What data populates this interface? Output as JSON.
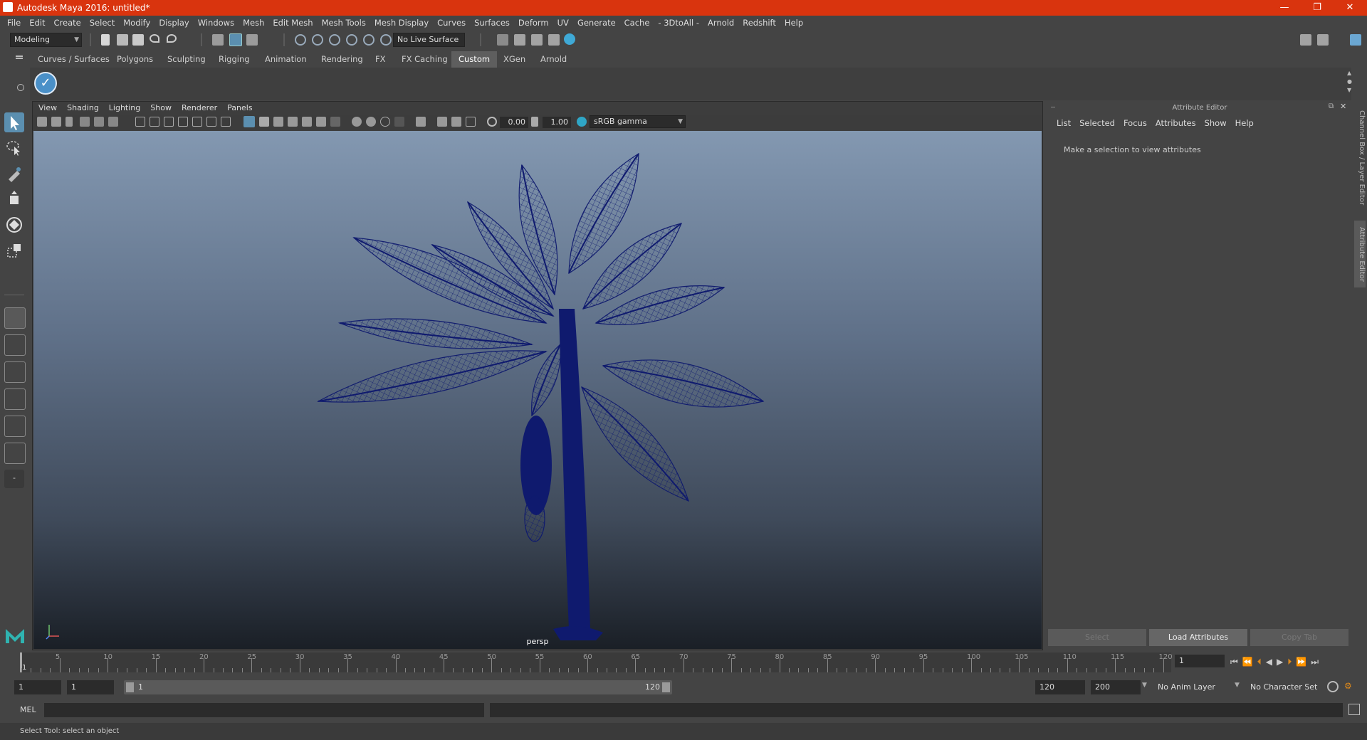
{
  "window": {
    "title": "Autodesk Maya 2016: untitled*",
    "minimize": "—",
    "restore": "❐",
    "close": "✕"
  },
  "menu": [
    "File",
    "Edit",
    "Create",
    "Select",
    "Modify",
    "Display",
    "Windows",
    "Mesh",
    "Edit Mesh",
    "Mesh Tools",
    "Mesh Display",
    "Curves",
    "Surfaces",
    "Deform",
    "UV",
    "Generate",
    "Cache",
    "- 3DtoAll -",
    "Arnold",
    "Redshift",
    "Help"
  ],
  "status": {
    "menuset": "Modeling",
    "live_surface": "No Live Surface"
  },
  "shelf_tabs": [
    "Curves / Surfaces",
    "Polygons",
    "Sculpting",
    "Rigging",
    "Animation",
    "Rendering",
    "FX",
    "FX Caching",
    "Custom",
    "XGen",
    "Arnold"
  ],
  "shelf_active": "Custom",
  "viewport": {
    "menu": [
      "View",
      "Shading",
      "Lighting",
      "Show",
      "Renderer",
      "Panels"
    ],
    "exposure": "0.00",
    "gamma": "1.00",
    "colorspace": "sRGB gamma",
    "camera": "persp"
  },
  "attribute_editor": {
    "title": "Attribute Editor",
    "menu": [
      "List",
      "Selected",
      "Focus",
      "Attributes",
      "Show",
      "Help"
    ],
    "message": "Make a selection to view attributes",
    "buttons": {
      "select": "Select",
      "load": "Load Attributes",
      "copy": "Copy Tab"
    }
  },
  "side_tabs": {
    "channel_box": "Channel Box / Layer Editor",
    "attr_editor": "Attribute Editor"
  },
  "timeline": {
    "labels": [
      "5",
      "10",
      "15",
      "20",
      "25",
      "30",
      "35",
      "40",
      "45",
      "50",
      "55",
      "60",
      "65",
      "70",
      "75",
      "80",
      "85",
      "90",
      "95",
      "100",
      "105",
      "110",
      "115",
      "120"
    ],
    "first": "1",
    "current_frame": "1"
  },
  "range": {
    "start": "1",
    "playback_start": "1",
    "slider_start": "1",
    "slider_end": "120",
    "playback_end": "120",
    "end": "200",
    "anim_layer": "No Anim Layer",
    "character_set": "No Character Set"
  },
  "command": {
    "label": "MEL"
  },
  "help_line": "Select Tool: select an object",
  "colors": {
    "titlebar": "#d9340e",
    "mesh": "#0f1a6e",
    "active_tab": "#5e5e5e"
  }
}
